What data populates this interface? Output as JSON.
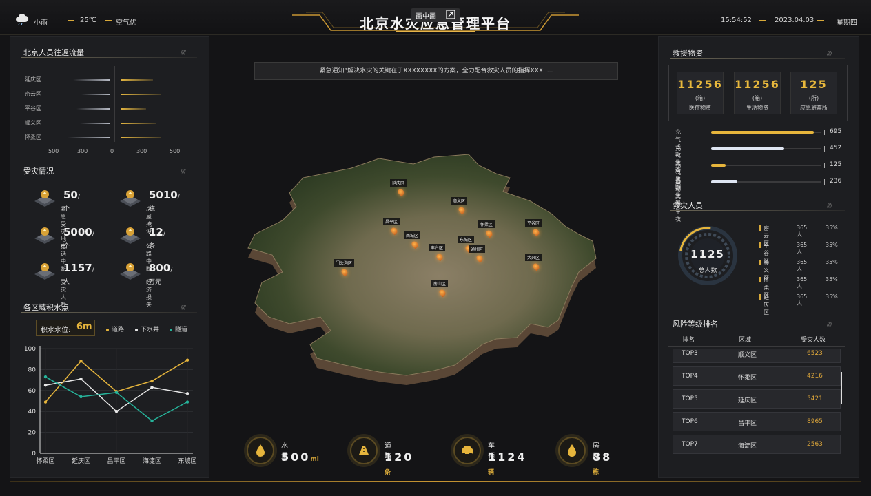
{
  "header": {
    "weather": "小雨",
    "temperature": "25℃",
    "air_quality": "空气优",
    "title": "北京水灾应急管理平台",
    "time": "15:54:52",
    "date": "2023.04.03",
    "weekday": "星期四"
  },
  "pip": {
    "label": "画中画"
  },
  "flow_panel": {
    "title": "北京人员往返流量",
    "districts": [
      "延庆区",
      "密云区",
      "平谷区",
      "顺义区",
      "怀柔区"
    ],
    "left_values": [
      270,
      210,
      245,
      220,
      310
    ],
    "right_values": [
      230,
      290,
      180,
      250,
      290
    ],
    "axis_ticks": [
      "500",
      "300",
      "0",
      "300",
      "500"
    ],
    "axis_max": 500
  },
  "disaster_panel": {
    "title": "受灾情况",
    "stats": [
      {
        "value": "50",
        "unit": "/个",
        "label": "紧急受灾地点"
      },
      {
        "value": "5010",
        "unit": "/栋",
        "label": "房屋掩没"
      },
      {
        "value": "5000",
        "unit": "/个",
        "label": "电话中断"
      },
      {
        "value": "12",
        "unit": "/条",
        "label": "公路中断"
      },
      {
        "value": "1157",
        "unit": "/人",
        "label": "受灾人数"
      },
      {
        "value": "800",
        "unit": "/万元",
        "label": "经济损失"
      }
    ]
  },
  "water_panel": {
    "title": "各区域积水点",
    "level_label": "积水水位:",
    "level_value": "6m",
    "legend": [
      "道路",
      "下水井",
      "隧道"
    ],
    "colors": [
      "#e6b53c",
      "#e8e8e8",
      "#26b39a"
    ]
  },
  "chart_data": {
    "type": "line",
    "categories": [
      "怀柔区",
      "延庆区",
      "昌平区",
      "海淀区",
      "东城区"
    ],
    "series": [
      {
        "name": "道路",
        "values": [
          49,
          88,
          59,
          69,
          89
        ]
      },
      {
        "name": "下水井",
        "values": [
          65,
          71,
          40,
          63,
          57
        ]
      },
      {
        "name": "隧道",
        "values": [
          73,
          54,
          58,
          31,
          49
        ]
      }
    ],
    "ylim": [
      0,
      100
    ],
    "yticks": [
      "0",
      "20",
      "40",
      "60",
      "80",
      "100"
    ],
    "grid": true
  },
  "notice": {
    "text": "紧急通知“解决水灾的关键在于XXXXXXXX的方案，全力配合救灾人员的指挥XXX....."
  },
  "bottom_stats": [
    {
      "label": "水量",
      "value": "500",
      "unit": "ml"
    },
    {
      "label": "道路",
      "value": "120",
      "unit": "条"
    },
    {
      "label": "车辆",
      "value": "1124",
      "unit": "辆"
    },
    {
      "label": "房屋",
      "value": "88",
      "unit": "栋"
    }
  ],
  "materials_panel": {
    "title": "救援物资",
    "boxes": [
      {
        "value": "11256",
        "unit": "(箱)",
        "label": "医疗物资"
      },
      {
        "value": "11256",
        "unit": "(箱)",
        "label": "生活物资"
      },
      {
        "value": "125",
        "unit": "(所)",
        "label": "应急避难所"
      }
    ],
    "bars": [
      {
        "label": "充气式救生衣",
        "value": "695",
        "fraction": 0.93,
        "color": "#e6b53c"
      },
      {
        "label": "充气式救生圈",
        "value": "452",
        "fraction": 0.66,
        "color": "#dfe6f3"
      },
      {
        "label": "充气式救生船",
        "value": "125",
        "fraction": 0.13,
        "color": "#e6b53c"
      },
      {
        "label": "自动式救生衣",
        "value": "236",
        "fraction": 0.24,
        "color": "#dfe6f3"
      }
    ]
  },
  "rescue_panel": {
    "title": "救灾人员",
    "total_value": "1125",
    "total_label": "总人数",
    "rows": [
      {
        "district": "密云区",
        "count": "365人",
        "percent": "35%"
      },
      {
        "district": "平谷区",
        "count": "365人",
        "percent": "35%"
      },
      {
        "district": "顺义区",
        "count": "365人",
        "percent": "35%"
      },
      {
        "district": "怀柔区",
        "count": "365人",
        "percent": "35%"
      },
      {
        "district": "延庆区",
        "count": "365人",
        "percent": "35%"
      }
    ]
  },
  "ranking_panel": {
    "title": "风险等级排名",
    "headers": [
      "排名",
      "区域",
      "受灾人数"
    ],
    "rows": [
      {
        "rank": "TOP3",
        "district": "顺义区",
        "value": "6523"
      },
      {
        "rank": "TOP4",
        "district": "怀柔区",
        "value": "4216"
      },
      {
        "rank": "TOP5",
        "district": "延庆区",
        "value": "5421"
      },
      {
        "rank": "TOP6",
        "district": "昌平区",
        "value": "8965"
      },
      {
        "rank": "TOP7",
        "district": "海淀区",
        "value": "2563"
      }
    ]
  },
  "map": {
    "labels": [
      {
        "text": "门头沟区"
      },
      {
        "text": "房山区"
      },
      {
        "text": "大兴区"
      },
      {
        "text": "丰台区"
      },
      {
        "text": "西城区"
      },
      {
        "text": "东城区"
      },
      {
        "text": "通州区"
      },
      {
        "text": "昌平区"
      },
      {
        "text": "顺义区"
      },
      {
        "text": "怀柔区"
      },
      {
        "text": "延庆区"
      },
      {
        "text": "平谷区"
      }
    ]
  }
}
